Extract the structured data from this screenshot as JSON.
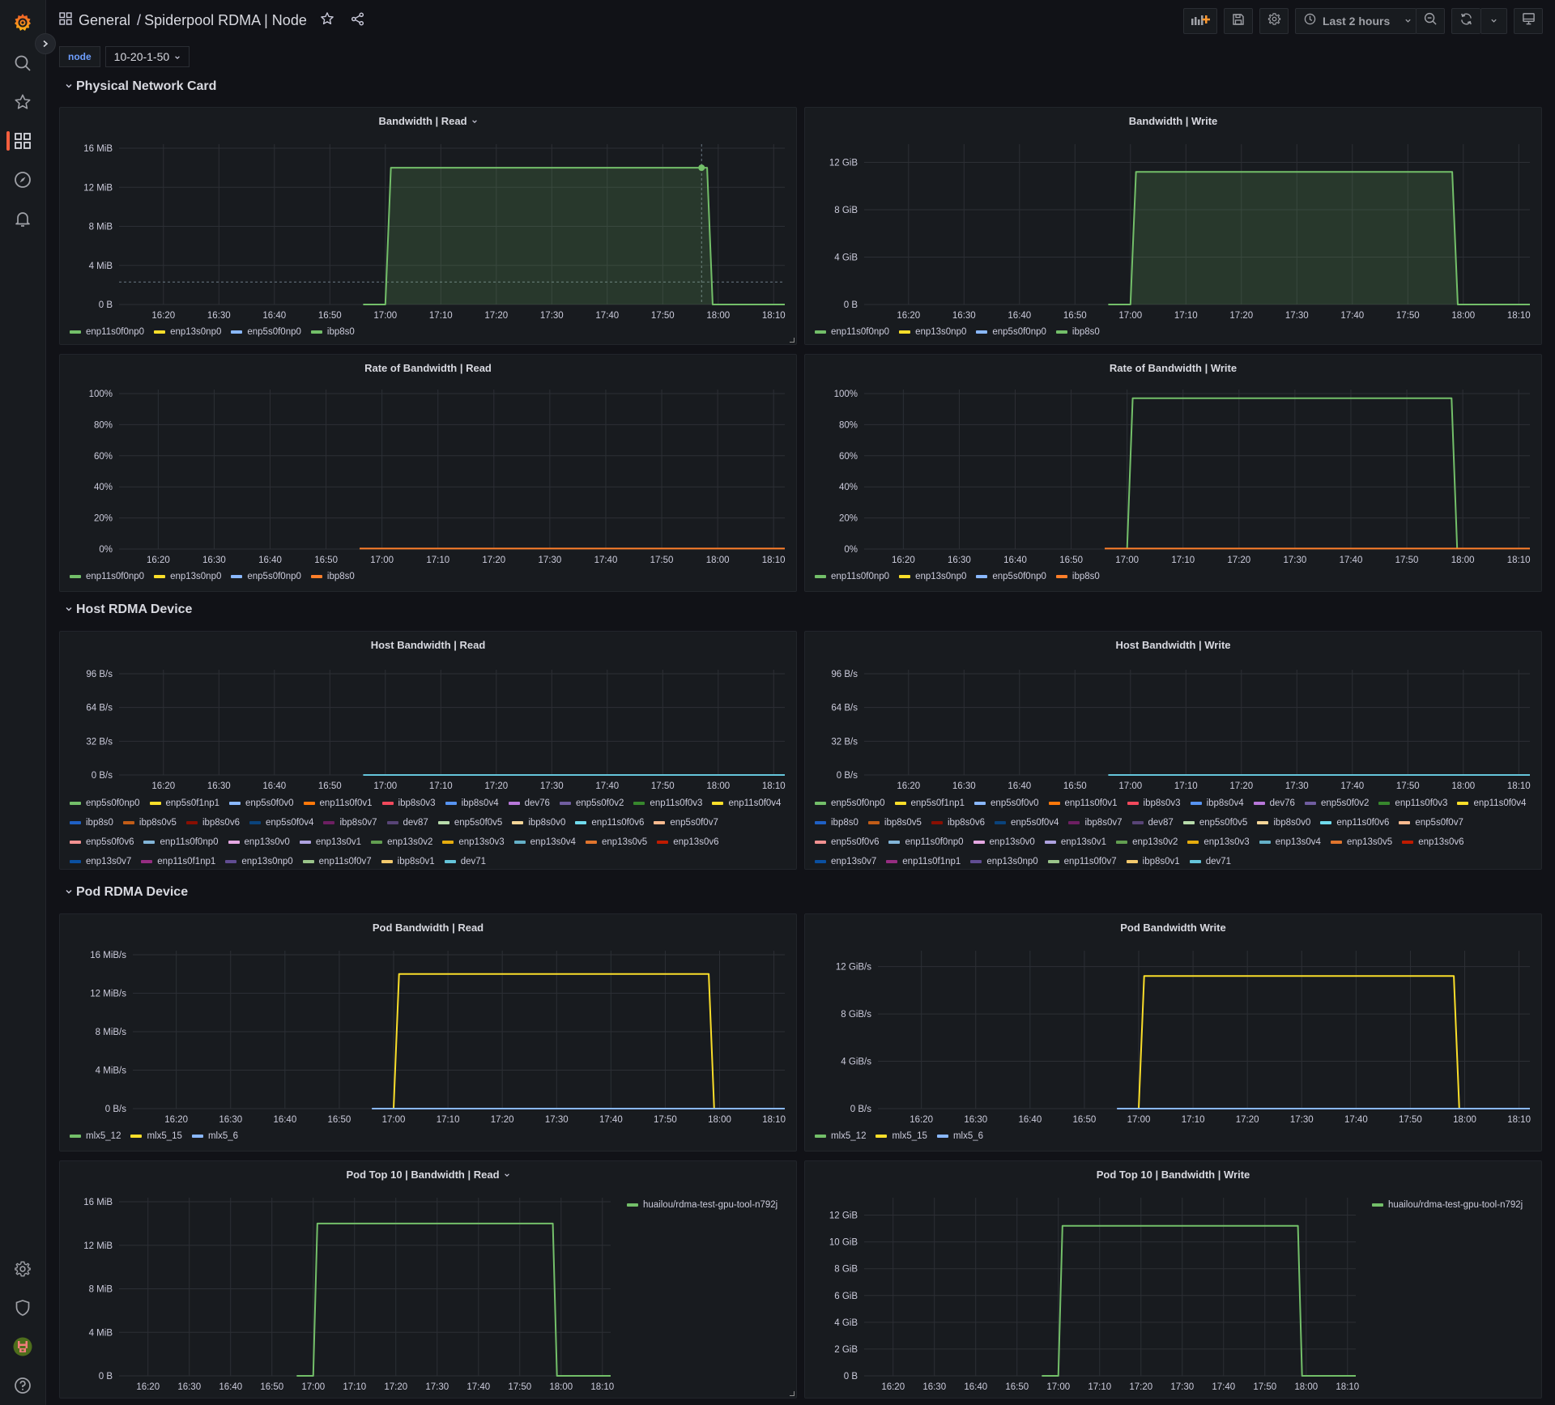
{
  "header": {
    "folder": "General",
    "separator": "/",
    "dashboard_title": "Spiderpool RDMA | Node",
    "time_range": "Last 2 hours"
  },
  "toolbar": {
    "icons": [
      "add-panel-icon",
      "save-icon",
      "settings-icon",
      "clock-icon",
      "zoom-out-icon",
      "refresh-icon",
      "chevron-down-icon",
      "tv-mode-icon"
    ]
  },
  "sidebar": {
    "top": [
      "grafana-logo",
      "search-icon",
      "star-icon",
      "dashboards-icon",
      "explore-icon",
      "alerting-icon"
    ],
    "bottom": [
      "settings-icon",
      "shield-icon",
      "user-avatar",
      "help-icon"
    ],
    "active": "dashboards-icon"
  },
  "variables": {
    "label": "node",
    "value": "10-20-1-50"
  },
  "rows": [
    {
      "title": "Physical Network Card"
    },
    {
      "title": "Host RDMA Device"
    },
    {
      "title": "Pod RDMA Device"
    }
  ],
  "legends": {
    "physical": [
      {
        "name": "enp11s0f0np0",
        "color": "#73bf69"
      },
      {
        "name": "enp13s0np0",
        "color": "#fade2a"
      },
      {
        "name": "enp5s0f0np0",
        "color": "#8ab8ff"
      },
      {
        "name": "ibp8s0",
        "color": "#73bf69"
      }
    ],
    "physical_rate": [
      {
        "name": "enp11s0f0np0",
        "color": "#73bf69"
      },
      {
        "name": "enp13s0np0",
        "color": "#fade2a"
      },
      {
        "name": "enp5s0f0np0",
        "color": "#8ab8ff"
      },
      {
        "name": "ibp8s0",
        "color": "#ff7f2a"
      }
    ],
    "host": [
      {
        "name": "enp5s0f0np0",
        "color": "#73bf69"
      },
      {
        "name": "enp5s0f1np1",
        "color": "#fade2a"
      },
      {
        "name": "enp5s0f0v0",
        "color": "#8ab8ff"
      },
      {
        "name": "enp11s0f0v1",
        "color": "#ff780a"
      },
      {
        "name": "ibp8s0v3",
        "color": "#f2495c"
      },
      {
        "name": "ibp8s0v4",
        "color": "#5794f2"
      },
      {
        "name": "dev76",
        "color": "#b877d9"
      },
      {
        "name": "enp5s0f0v2",
        "color": "#705da0"
      },
      {
        "name": "enp11s0f0v3",
        "color": "#37872d"
      },
      {
        "name": "enp11s0f0v4",
        "color": "#fade2a"
      },
      {
        "name": "ibp8s0",
        "color": "#1f60c4"
      },
      {
        "name": "ibp8s0v5",
        "color": "#c15c17"
      },
      {
        "name": "ibp8s0v6",
        "color": "#890f02"
      },
      {
        "name": "enp5s0f0v4",
        "color": "#0a437c"
      },
      {
        "name": "ibp8s0v7",
        "color": "#6d1f62"
      },
      {
        "name": "dev87",
        "color": "#584477"
      },
      {
        "name": "enp5s0f0v5",
        "color": "#b7dbab"
      },
      {
        "name": "ibp8s0v0",
        "color": "#f4d598"
      },
      {
        "name": "enp11s0f0v6",
        "color": "#70dbed"
      },
      {
        "name": "enp5s0f0v7",
        "color": "#f9ba8f"
      },
      {
        "name": "enp5s0f0v6",
        "color": "#f29191"
      },
      {
        "name": "enp11s0f0np0",
        "color": "#82b5d8"
      },
      {
        "name": "enp13s0v0",
        "color": "#e5a8e2"
      },
      {
        "name": "enp13s0v1",
        "color": "#aea2e0"
      },
      {
        "name": "enp13s0v2",
        "color": "#629e51"
      },
      {
        "name": "enp13s0v3",
        "color": "#e5ac0e"
      },
      {
        "name": "enp13s0v4",
        "color": "#64b0c8"
      },
      {
        "name": "enp13s0v5",
        "color": "#e0752d"
      },
      {
        "name": "enp13s0v6",
        "color": "#bf1b00"
      },
      {
        "name": "enp13s0v7",
        "color": "#0a50a1"
      },
      {
        "name": "enp11s0f1np1",
        "color": "#962d82"
      },
      {
        "name": "enp13s0np0",
        "color": "#614d93"
      },
      {
        "name": "enp11s0f0v7",
        "color": "#9ac48a"
      },
      {
        "name": "ibp8s0v1",
        "color": "#f2c96d"
      },
      {
        "name": "dev71",
        "color": "#65c5db"
      }
    ],
    "pod": [
      {
        "name": "mlx5_12",
        "color": "#73bf69"
      },
      {
        "name": "mlx5_15",
        "color": "#fade2a"
      },
      {
        "name": "mlx5_6",
        "color": "#8ab8ff"
      }
    ],
    "pod_top": [
      {
        "name": "huailou/rdma-test-gpu-tool-n792j",
        "color": "#73bf69"
      }
    ]
  },
  "chart_data": [
    {
      "id": "bw-read",
      "type": "line",
      "title": "Bandwidth | Read",
      "has_menu": true,
      "x": [
        "16:20",
        "16:30",
        "16:40",
        "16:50",
        "17:00",
        "17:10",
        "17:20",
        "17:30",
        "17:40",
        "17:50",
        "18:00",
        "18:10"
      ],
      "xlim": [
        "16:12",
        "18:12"
      ],
      "yticks": [
        "0 B",
        "4 MiB",
        "8 MiB",
        "12 MiB",
        "16 MiB"
      ],
      "ylim": [
        0,
        16
      ],
      "fill": true,
      "series": [
        {
          "name": "ibp8s0",
          "color": "#73bf69",
          "points": [
            [
              "16:56",
              0
            ],
            [
              "17:00",
              0
            ],
            [
              "17:01",
              14
            ],
            [
              "17:57",
              14
            ],
            [
              "17:58",
              14
            ],
            [
              "17:59",
              0
            ],
            [
              "18:12",
              0
            ]
          ]
        }
      ],
      "hover": {
        "x": "17:57",
        "y": 14,
        "threshold_y": 2.3
      }
    },
    {
      "id": "bw-write",
      "type": "line",
      "title": "Bandwidth | Write",
      "x": [
        "16:20",
        "16:30",
        "16:40",
        "16:50",
        "17:00",
        "17:10",
        "17:20",
        "17:30",
        "17:40",
        "17:50",
        "18:00",
        "18:10"
      ],
      "xlim": [
        "16:12",
        "18:12"
      ],
      "yticks": [
        "0 B",
        "4 GiB",
        "8 GiB",
        "12 GiB"
      ],
      "ylim": [
        0,
        13.2
      ],
      "fill": true,
      "series": [
        {
          "name": "ibp8s0",
          "color": "#73bf69",
          "points": [
            [
              "16:56",
              0
            ],
            [
              "17:00",
              0
            ],
            [
              "17:01",
              11.2
            ],
            [
              "17:58",
              11.2
            ],
            [
              "17:59",
              0
            ],
            [
              "18:12",
              0
            ]
          ]
        }
      ]
    },
    {
      "id": "rate-read",
      "type": "line",
      "title": "Rate of Bandwidth | Read",
      "x": [
        "16:20",
        "16:30",
        "16:40",
        "16:50",
        "17:00",
        "17:10",
        "17:20",
        "17:30",
        "17:40",
        "17:50",
        "18:00",
        "18:10"
      ],
      "xlim": [
        "16:13",
        "18:12"
      ],
      "yticks": [
        "0%",
        "20%",
        "40%",
        "60%",
        "80%",
        "100%"
      ],
      "ylim": [
        0,
        100
      ],
      "series": [
        {
          "name": "ibp8s0",
          "color": "#ff7f2a",
          "points": [
            [
              "16:56",
              0.3
            ],
            [
              "18:12",
              0.3
            ]
          ]
        }
      ]
    },
    {
      "id": "rate-write",
      "type": "line",
      "title": "Rate of Bandwidth | Write",
      "x": [
        "16:20",
        "16:30",
        "16:40",
        "16:50",
        "17:00",
        "17:10",
        "17:20",
        "17:30",
        "17:40",
        "17:50",
        "18:00",
        "18:10"
      ],
      "xlim": [
        "16:13",
        "18:12"
      ],
      "yticks": [
        "0%",
        "20%",
        "40%",
        "60%",
        "80%",
        "100%"
      ],
      "ylim": [
        0,
        100
      ],
      "series": [
        {
          "name": "enp11s0f0np0",
          "color": "#73bf69",
          "points": [
            [
              "17:00",
              0
            ],
            [
              "17:01",
              97
            ],
            [
              "17:58",
              97
            ],
            [
              "17:59",
              0
            ]
          ]
        },
        {
          "name": "ibp8s0",
          "color": "#ff7f2a",
          "points": [
            [
              "16:56",
              0.3
            ],
            [
              "18:12",
              0.3
            ]
          ]
        }
      ]
    },
    {
      "id": "host-read",
      "type": "line",
      "title": "Host Bandwidth | Read",
      "x": [
        "16:20",
        "16:30",
        "16:40",
        "16:50",
        "17:00",
        "17:10",
        "17:20",
        "17:30",
        "17:40",
        "17:50",
        "18:00",
        "18:10"
      ],
      "xlim": [
        "16:12",
        "18:12"
      ],
      "yticks": [
        "0 B/s",
        "32 B/s",
        "64 B/s",
        "96 B/s"
      ],
      "ylim": [
        0,
        96
      ],
      "series": [
        {
          "name": "dev71",
          "color": "#65c5db",
          "points": [
            [
              "16:56",
              0
            ],
            [
              "18:12",
              0
            ]
          ]
        }
      ]
    },
    {
      "id": "host-write",
      "type": "line",
      "title": "Host Bandwidth | Write",
      "x": [
        "16:20",
        "16:30",
        "16:40",
        "16:50",
        "17:00",
        "17:10",
        "17:20",
        "17:30",
        "17:40",
        "17:50",
        "18:00",
        "18:10"
      ],
      "xlim": [
        "16:12",
        "18:12"
      ],
      "yticks": [
        "0 B/s",
        "32 B/s",
        "64 B/s",
        "96 B/s"
      ],
      "ylim": [
        0,
        96
      ],
      "series": [
        {
          "name": "dev71",
          "color": "#65c5db",
          "points": [
            [
              "16:56",
              0
            ],
            [
              "18:12",
              0
            ]
          ]
        }
      ]
    },
    {
      "id": "pod-read",
      "type": "line",
      "title": "Pod Bandwidth | Read",
      "x": [
        "16:20",
        "16:30",
        "16:40",
        "16:50",
        "17:00",
        "17:10",
        "17:20",
        "17:30",
        "17:40",
        "17:50",
        "18:00",
        "18:10"
      ],
      "xlim": [
        "16:12",
        "18:12"
      ],
      "yticks": [
        "0 B/s",
        "4 MiB/s",
        "8 MiB/s",
        "12 MiB/s",
        "16 MiB/s"
      ],
      "ylim": [
        0,
        16
      ],
      "series": [
        {
          "name": "mlx5_15",
          "color": "#fade2a",
          "points": [
            [
              "17:00",
              0
            ],
            [
              "17:01",
              14
            ],
            [
              "17:58",
              14
            ],
            [
              "17:59",
              0
            ]
          ]
        },
        {
          "name": "mlx5_6",
          "color": "#8ab8ff",
          "points": [
            [
              "16:56",
              0
            ],
            [
              "18:12",
              0
            ]
          ]
        }
      ]
    },
    {
      "id": "pod-write",
      "type": "line",
      "title": "Pod Bandwidth Write",
      "x": [
        "16:20",
        "16:30",
        "16:40",
        "16:50",
        "17:00",
        "17:10",
        "17:20",
        "17:30",
        "17:40",
        "17:50",
        "18:00",
        "18:10"
      ],
      "xlim": [
        "16:12",
        "18:12"
      ],
      "yticks": [
        "0 B/s",
        "4 GiB/s",
        "8 GiB/s",
        "12 GiB/s"
      ],
      "ylim": [
        0,
        13
      ],
      "series": [
        {
          "name": "mlx5_15",
          "color": "#fade2a",
          "points": [
            [
              "17:00",
              0
            ],
            [
              "17:01",
              11.2
            ],
            [
              "17:58",
              11.2
            ],
            [
              "17:59",
              0
            ]
          ]
        },
        {
          "name": "mlx5_6",
          "color": "#8ab8ff",
          "points": [
            [
              "16:56",
              0
            ],
            [
              "18:12",
              0
            ]
          ]
        }
      ]
    },
    {
      "id": "top-read",
      "type": "line",
      "title": "Pod Top 10 | Bandwidth | Read",
      "has_menu": true,
      "x": [
        "16:20",
        "16:30",
        "16:40",
        "16:50",
        "17:00",
        "17:10",
        "17:20",
        "17:30",
        "17:40",
        "17:50",
        "18:00",
        "18:10"
      ],
      "xlim": [
        "16:13",
        "18:12"
      ],
      "yticks": [
        "0 B",
        "4 MiB",
        "8 MiB",
        "12 MiB",
        "16 MiB"
      ],
      "ylim": [
        0,
        16
      ],
      "series": [
        {
          "name": "huailou/rdma-test-gpu-tool-n792j",
          "color": "#73bf69",
          "points": [
            [
              "16:56",
              0
            ],
            [
              "17:00",
              0
            ],
            [
              "17:01",
              14
            ],
            [
              "17:58",
              14
            ],
            [
              "17:59",
              0
            ],
            [
              "18:12",
              0
            ]
          ]
        }
      ]
    },
    {
      "id": "top-write",
      "type": "line",
      "title": "Pod Top 10 | Bandwidth | Write",
      "x": [
        "16:20",
        "16:30",
        "16:40",
        "16:50",
        "17:00",
        "17:10",
        "17:20",
        "17:30",
        "17:40",
        "17:50",
        "18:00",
        "18:10"
      ],
      "xlim": [
        "16:13",
        "18:12"
      ],
      "yticks": [
        "0 B",
        "2 GiB",
        "4 GiB",
        "6 GiB",
        "8 GiB",
        "10 GiB",
        "12 GiB"
      ],
      "ylim": [
        0,
        13
      ],
      "series": [
        {
          "name": "huailou/rdma-test-gpu-tool-n792j",
          "color": "#73bf69",
          "points": [
            [
              "16:56",
              0
            ],
            [
              "17:00",
              0
            ],
            [
              "17:01",
              11.2
            ],
            [
              "17:58",
              11.2
            ],
            [
              "17:59",
              0
            ],
            [
              "18:12",
              0
            ]
          ]
        }
      ]
    }
  ]
}
